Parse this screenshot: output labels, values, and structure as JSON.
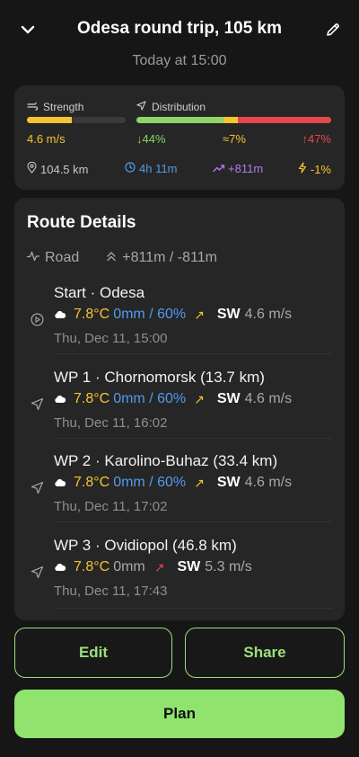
{
  "header": {
    "title": "Odesa round trip, 105 km",
    "subtitle": "Today at 15:00"
  },
  "summary": {
    "strength_label": "Strength",
    "strength_value": "4.6 m/s",
    "strength_fill_fraction": 0.45,
    "distribution_label": "Distribution",
    "distribution": {
      "tailwind_pct": 44,
      "crosswind_pct": 7,
      "headwind_pct": 47,
      "tailwind_text": "↓44%",
      "crosswind_text": "≈7%",
      "headwind_text": "↑47%"
    },
    "distance": "104.5 km",
    "duration": "4h 11m",
    "elevation_gain": "+811m",
    "energy_effect": "-1%",
    "colors": {
      "yellow": "#f5c531",
      "green": "#8ed468",
      "red": "#e5484d",
      "blue": "#4f9bf0",
      "purple": "#b07cf2"
    }
  },
  "route": {
    "title": "Route Details",
    "surface": "Road",
    "elevation": "+811m / -811m",
    "waypoints": [
      {
        "name": "Start · Odesa",
        "icon": "play-circle-icon",
        "temp": "7.8°C",
        "precip": "0mm / 60%",
        "precip_style": "blue",
        "wind_arrow": "↗",
        "wind_arrow_color": "#f5c531",
        "wind_dir": "SW",
        "wind_speed": "4.6 m/s",
        "datetime": "Thu, Dec 11, 15:00"
      },
      {
        "name": "WP 1 · Chornomorsk (13.7 km)",
        "icon": "navigation-arrow-icon",
        "temp": "7.8°C",
        "precip": "0mm / 60%",
        "precip_style": "blue",
        "wind_arrow": "↗",
        "wind_arrow_color": "#f5c531",
        "wind_dir": "SW",
        "wind_speed": "4.6 m/s",
        "datetime": "Thu, Dec 11, 16:02"
      },
      {
        "name": "WP 2 · Karolino-Buhaz (33.4 km)",
        "icon": "navigation-arrow-icon",
        "temp": "7.8°C",
        "precip": "0mm / 60%",
        "precip_style": "blue",
        "wind_arrow": "↗",
        "wind_arrow_color": "#f5c531",
        "wind_dir": "SW",
        "wind_speed": "4.6 m/s",
        "datetime": "Thu, Dec 11, 17:02"
      },
      {
        "name": "WP 3 · Ovidiopol (46.8 km)",
        "icon": "navigation-arrow-icon",
        "temp": "7.8°C",
        "precip": "0mm",
        "precip_style": "grey",
        "wind_arrow": "↗",
        "wind_arrow_color": "#e5484d",
        "wind_dir": "SW",
        "wind_speed": "5.3 m/s",
        "datetime": "Thu, Dec 11, 17:43"
      }
    ]
  },
  "actions": {
    "edit_label": "Edit",
    "share_label": "Share",
    "plan_label": "Plan"
  }
}
